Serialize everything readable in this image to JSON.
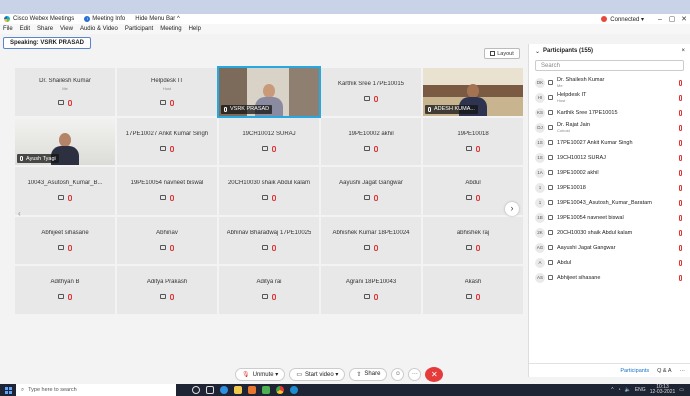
{
  "titlebar": {
    "app_title": "Cisco Webex Meetings",
    "meeting_info": "Meeting Info",
    "hide_menu_bar": "Hide Menu Bar ^",
    "connection_status": "Connected ▾"
  },
  "menu": [
    "File",
    "Edit",
    "Share",
    "View",
    "Audio & Video",
    "Participant",
    "Meeting",
    "Help"
  ],
  "speaking": "Speaking: VSRK PRASAD",
  "layout_label": "Layout",
  "tiles": [
    {
      "name": "Dr. Shailesh Kumar",
      "sub": "Me"
    },
    {
      "name": "Helpdesk IT",
      "sub": "Host"
    },
    {
      "name": "VSRK PRASAD",
      "video": true,
      "active": true
    },
    {
      "name": "Karthik Sree 17PE10015"
    },
    {
      "name": "ADESH KUMA...",
      "video": true
    },
    {
      "name": "Ayush Tyagi",
      "video": true
    },
    {
      "name": "17PE10027 Ankit Kumar Singh"
    },
    {
      "name": "19CH10012 SURAJ"
    },
    {
      "name": "19PE10002 akhil"
    },
    {
      "name": "19PE10018"
    },
    {
      "name": "10043_Asutosh_Kumar_B..."
    },
    {
      "name": "19PE10054 navneet biswal"
    },
    {
      "name": "20CH10030 shaik Abdul kalam"
    },
    {
      "name": "Aayushi Jagat Gangwar"
    },
    {
      "name": "Abdul"
    },
    {
      "name": "Abhijeet sihasane"
    },
    {
      "name": "Abhinav"
    },
    {
      "name": "Abhinav Bharadwaj 17PE10025"
    },
    {
      "name": "Abhishek Kumar 18PE10024"
    },
    {
      "name": "abhishek raj"
    },
    {
      "name": "Adithyan B"
    },
    {
      "name": "Aditya Prakash"
    },
    {
      "name": "Aditya rai"
    },
    {
      "name": "Agrani 18PE10043"
    },
    {
      "name": "Akash"
    }
  ],
  "participants_panel": {
    "title": "Participants (155)",
    "search_placeholder": "Search",
    "items": [
      {
        "initials": "DK",
        "name": "Dr. Shailesh Kumar",
        "role": "Me"
      },
      {
        "initials": "HI",
        "name": "Helpdesk IT",
        "role": "Host"
      },
      {
        "initials": "KS",
        "name": "Karthik Sree 17PE10015"
      },
      {
        "initials": "DJ",
        "name": "Dr. Rajat Jain",
        "role": "Cohost"
      },
      {
        "initials": "1S",
        "name": "17PE10027 Ankit Kumar Singh"
      },
      {
        "initials": "1S",
        "name": "19CH10012 SURAJ"
      },
      {
        "initials": "1A",
        "name": "19PE10002 akhil"
      },
      {
        "initials": "1",
        "name": "19PE10018"
      },
      {
        "initials": "1",
        "name": "19PE10043_Asutosh_Kumar_Baratam"
      },
      {
        "initials": "1B",
        "name": "19PE10054 navneet biswal"
      },
      {
        "initials": "2K",
        "name": "20CH10030 shaik Abdul kalam"
      },
      {
        "initials": "AG",
        "name": "Aayushi Jagat Gangwar"
      },
      {
        "initials": "A",
        "name": "Abdul"
      },
      {
        "initials": "AS",
        "name": "Abhijeet sihasane"
      }
    ],
    "footer_participants": "Participants",
    "footer_qa": "Q & A",
    "footer_more": "···"
  },
  "controls": {
    "unmute": "Unmute ▾",
    "start_video": "Start video ▾",
    "share": "Share"
  },
  "taskbar": {
    "search_placeholder": "Type here to search",
    "language": "ENG",
    "time": "10:13",
    "date": "12-03-2021"
  }
}
